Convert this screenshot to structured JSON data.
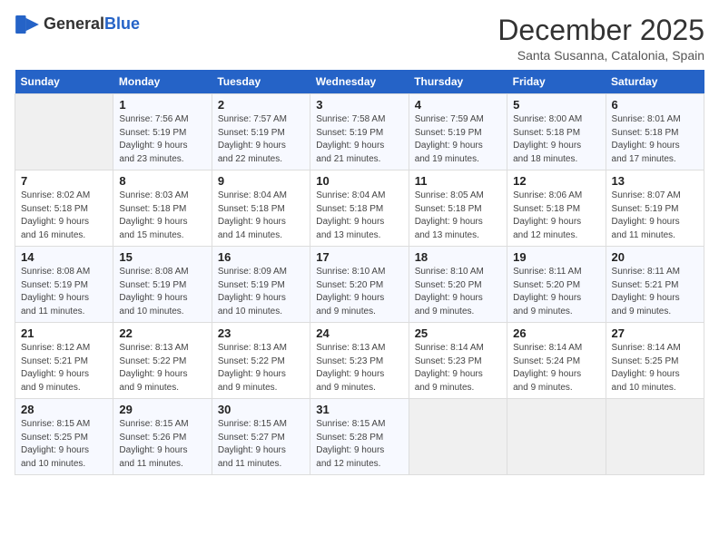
{
  "header": {
    "logo_general": "General",
    "logo_blue": "Blue",
    "month_year": "December 2025",
    "location": "Santa Susanna, Catalonia, Spain"
  },
  "weekdays": [
    "Sunday",
    "Monday",
    "Tuesday",
    "Wednesday",
    "Thursday",
    "Friday",
    "Saturday"
  ],
  "weeks": [
    [
      {
        "day": "",
        "info": ""
      },
      {
        "day": "1",
        "info": "Sunrise: 7:56 AM\nSunset: 5:19 PM\nDaylight: 9 hours\nand 23 minutes."
      },
      {
        "day": "2",
        "info": "Sunrise: 7:57 AM\nSunset: 5:19 PM\nDaylight: 9 hours\nand 22 minutes."
      },
      {
        "day": "3",
        "info": "Sunrise: 7:58 AM\nSunset: 5:19 PM\nDaylight: 9 hours\nand 21 minutes."
      },
      {
        "day": "4",
        "info": "Sunrise: 7:59 AM\nSunset: 5:19 PM\nDaylight: 9 hours\nand 19 minutes."
      },
      {
        "day": "5",
        "info": "Sunrise: 8:00 AM\nSunset: 5:18 PM\nDaylight: 9 hours\nand 18 minutes."
      },
      {
        "day": "6",
        "info": "Sunrise: 8:01 AM\nSunset: 5:18 PM\nDaylight: 9 hours\nand 17 minutes."
      }
    ],
    [
      {
        "day": "7",
        "info": "Sunrise: 8:02 AM\nSunset: 5:18 PM\nDaylight: 9 hours\nand 16 minutes."
      },
      {
        "day": "8",
        "info": "Sunrise: 8:03 AM\nSunset: 5:18 PM\nDaylight: 9 hours\nand 15 minutes."
      },
      {
        "day": "9",
        "info": "Sunrise: 8:04 AM\nSunset: 5:18 PM\nDaylight: 9 hours\nand 14 minutes."
      },
      {
        "day": "10",
        "info": "Sunrise: 8:04 AM\nSunset: 5:18 PM\nDaylight: 9 hours\nand 13 minutes."
      },
      {
        "day": "11",
        "info": "Sunrise: 8:05 AM\nSunset: 5:18 PM\nDaylight: 9 hours\nand 13 minutes."
      },
      {
        "day": "12",
        "info": "Sunrise: 8:06 AM\nSunset: 5:18 PM\nDaylight: 9 hours\nand 12 minutes."
      },
      {
        "day": "13",
        "info": "Sunrise: 8:07 AM\nSunset: 5:19 PM\nDaylight: 9 hours\nand 11 minutes."
      }
    ],
    [
      {
        "day": "14",
        "info": "Sunrise: 8:08 AM\nSunset: 5:19 PM\nDaylight: 9 hours\nand 11 minutes."
      },
      {
        "day": "15",
        "info": "Sunrise: 8:08 AM\nSunset: 5:19 PM\nDaylight: 9 hours\nand 10 minutes."
      },
      {
        "day": "16",
        "info": "Sunrise: 8:09 AM\nSunset: 5:19 PM\nDaylight: 9 hours\nand 10 minutes."
      },
      {
        "day": "17",
        "info": "Sunrise: 8:10 AM\nSunset: 5:20 PM\nDaylight: 9 hours\nand 9 minutes."
      },
      {
        "day": "18",
        "info": "Sunrise: 8:10 AM\nSunset: 5:20 PM\nDaylight: 9 hours\nand 9 minutes."
      },
      {
        "day": "19",
        "info": "Sunrise: 8:11 AM\nSunset: 5:20 PM\nDaylight: 9 hours\nand 9 minutes."
      },
      {
        "day": "20",
        "info": "Sunrise: 8:11 AM\nSunset: 5:21 PM\nDaylight: 9 hours\nand 9 minutes."
      }
    ],
    [
      {
        "day": "21",
        "info": "Sunrise: 8:12 AM\nSunset: 5:21 PM\nDaylight: 9 hours\nand 9 minutes."
      },
      {
        "day": "22",
        "info": "Sunrise: 8:13 AM\nSunset: 5:22 PM\nDaylight: 9 hours\nand 9 minutes."
      },
      {
        "day": "23",
        "info": "Sunrise: 8:13 AM\nSunset: 5:22 PM\nDaylight: 9 hours\nand 9 minutes."
      },
      {
        "day": "24",
        "info": "Sunrise: 8:13 AM\nSunset: 5:23 PM\nDaylight: 9 hours\nand 9 minutes."
      },
      {
        "day": "25",
        "info": "Sunrise: 8:14 AM\nSunset: 5:23 PM\nDaylight: 9 hours\nand 9 minutes."
      },
      {
        "day": "26",
        "info": "Sunrise: 8:14 AM\nSunset: 5:24 PM\nDaylight: 9 hours\nand 9 minutes."
      },
      {
        "day": "27",
        "info": "Sunrise: 8:14 AM\nSunset: 5:25 PM\nDaylight: 9 hours\nand 10 minutes."
      }
    ],
    [
      {
        "day": "28",
        "info": "Sunrise: 8:15 AM\nSunset: 5:25 PM\nDaylight: 9 hours\nand 10 minutes."
      },
      {
        "day": "29",
        "info": "Sunrise: 8:15 AM\nSunset: 5:26 PM\nDaylight: 9 hours\nand 11 minutes."
      },
      {
        "day": "30",
        "info": "Sunrise: 8:15 AM\nSunset: 5:27 PM\nDaylight: 9 hours\nand 11 minutes."
      },
      {
        "day": "31",
        "info": "Sunrise: 8:15 AM\nSunset: 5:28 PM\nDaylight: 9 hours\nand 12 minutes."
      },
      {
        "day": "",
        "info": ""
      },
      {
        "day": "",
        "info": ""
      },
      {
        "day": "",
        "info": ""
      }
    ]
  ]
}
